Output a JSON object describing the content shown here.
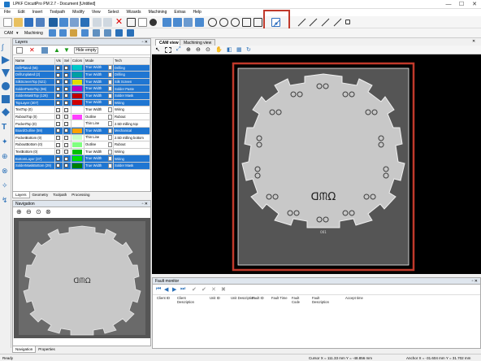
{
  "window": {
    "title": "LPKF CircuitPro PM 2.7 - Document [Untitled]",
    "minimize": "—",
    "maximize": "☐",
    "close": "✕"
  },
  "menu": [
    "File",
    "Edit",
    "Insert",
    "Toolpath",
    "Modify",
    "View",
    "Select",
    "Wizards",
    "Machining",
    "Extras",
    "Help"
  ],
  "toolbar2": {
    "cam_label": "CAM",
    "machining_label": "Machining"
  },
  "layers_panel": {
    "title": "Layers",
    "hide_empty": "Hide empty",
    "columns": [
      "Name",
      "Vis",
      "Sel",
      "Colors",
      "Mode",
      "Tech"
    ],
    "rows": [
      {
        "name": "DrillPlated (55)",
        "selected": true,
        "color": "#00c8c8",
        "mode": "True Width",
        "tech": "Drilling"
      },
      {
        "name": "DrillUnplated (2)",
        "selected": true,
        "color": "#00a0a0",
        "mode": "True Width",
        "tech": "Drilling"
      },
      {
        "name": "SilkScreenTop (521)",
        "selected": true,
        "color": "#e0e000",
        "mode": "True Width",
        "tech": "Silk Screen"
      },
      {
        "name": "SolderPasteTop (96)",
        "selected": true,
        "color": "#c000c0",
        "mode": "True Width",
        "tech": "Solder Paste"
      },
      {
        "name": "SolderMaskTop (126)",
        "selected": true,
        "color": "#c00000",
        "mode": "True Width",
        "tech": "Solder Mask"
      },
      {
        "name": "TopLayer (307)",
        "selected": true,
        "color": "#d00000",
        "mode": "True Width",
        "tech": "Wiring"
      },
      {
        "name": "TextTop (0)",
        "selected": false,
        "color": "#ffffff",
        "mode": "True Width",
        "tech": "Wiring"
      },
      {
        "name": "RuboutTop (0)",
        "selected": false,
        "color": "#ff40ff",
        "mode": "Outline",
        "tech": "Rubout"
      },
      {
        "name": "PocketTop (0)",
        "selected": false,
        "color": "#ffffff",
        "mode": "Thin Line",
        "tech": "2.5D milling top"
      },
      {
        "name": "BoardOutline (59)",
        "selected": true,
        "color": "#ffa000",
        "mode": "True Width",
        "tech": "Mechanical"
      },
      {
        "name": "PocketBottom (0)",
        "selected": false,
        "color": "#c8ffc8",
        "mode": "Thin Line",
        "tech": "2.5D milling bottom"
      },
      {
        "name": "RuboutBottom (0)",
        "selected": false,
        "color": "#80ff80",
        "mode": "Outline",
        "tech": "Rubout"
      },
      {
        "name": "TextBottom (0)",
        "selected": false,
        "color": "#00c000",
        "mode": "True Width",
        "tech": "Wiring"
      },
      {
        "name": "BottomLayer (37)",
        "selected": true,
        "color": "#00e000",
        "mode": "True Width",
        "tech": "Wiring"
      },
      {
        "name": "SolderMaskBottom (29)",
        "selected": true,
        "color": "#008000",
        "mode": "True Width",
        "tech": "Solder Mask"
      }
    ]
  },
  "left_tabs": [
    "Layers",
    "Geometry",
    "Toolpath",
    "Processing"
  ],
  "navigation_panel": {
    "title": "Navigation",
    "board_text": "ᗡᙏΩ"
  },
  "nav_tabs": [
    "Navigation",
    "Properties"
  ],
  "cam_tabs": [
    "CAM view",
    "Machining view"
  ],
  "cam_view": {
    "board_text": "ᗡᙏΩ",
    "small_label": "001"
  },
  "fault_monitor": {
    "title": "Fault monitor",
    "columns": [
      "Client ID",
      "Client Description",
      "Unit ID",
      "Unit Description",
      "Fault ID",
      "Fault Time",
      "Fault Code",
      "Fault Description",
      "Accept time"
    ]
  },
  "status": {
    "ready": "Ready",
    "cursor": "Cursor X =   111.33 mm    Y =  -48.856 mm",
    "anchor": "Anchor X =  -31.604 mm    Y =  31.702 mm"
  },
  "colors": {
    "selection_blue": "#1f76d2",
    "highlight_red": "#c0392b",
    "board_gray": "#c8c8c8"
  }
}
